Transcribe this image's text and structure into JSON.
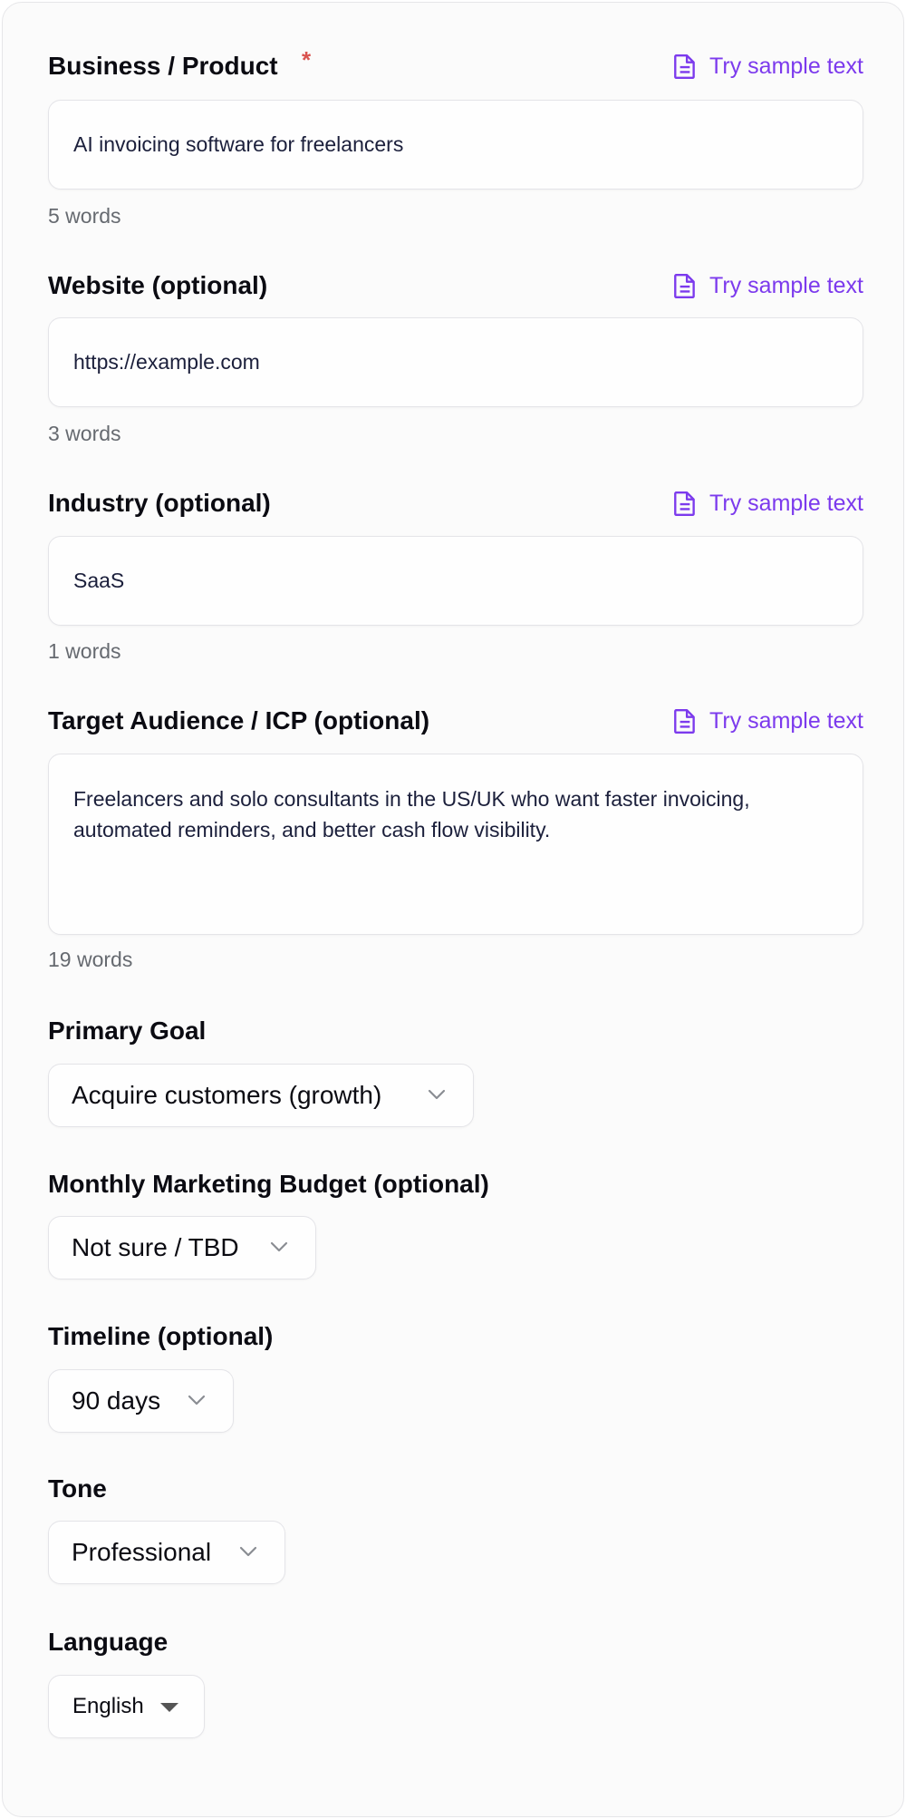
{
  "sample_label": "Try sample text",
  "fields": {
    "business": {
      "label": "Business / Product",
      "required_mark": "*",
      "value": "AI invoicing software for freelancers",
      "count": "5 words"
    },
    "website": {
      "label": "Website (optional)",
      "value": "https://example.com",
      "count": "3 words"
    },
    "industry": {
      "label": "Industry (optional)",
      "value": "SaaS",
      "count": "1 words"
    },
    "audience": {
      "label": "Target Audience / ICP (optional)",
      "value": "Freelancers and solo consultants in the US/UK who want faster invoicing, automated reminders, and better cash flow visibility.",
      "count": "19 words"
    }
  },
  "selects": {
    "goal": {
      "label": "Primary Goal",
      "value": "Acquire customers (growth)"
    },
    "budget": {
      "label": "Monthly Marketing Budget (optional)",
      "value": "Not sure / TBD"
    },
    "timeline": {
      "label": "Timeline (optional)",
      "value": "90 days"
    },
    "tone": {
      "label": "Tone",
      "value": "Professional"
    },
    "language": {
      "label": "Language",
      "value": "English"
    }
  },
  "colors": {
    "accent": "#7c3aed",
    "required": "#d9534f",
    "border": "#e4e4e8",
    "muted": "#666a70"
  },
  "icons": {
    "sample": "document-icon",
    "dropdown": "chevron-down-icon",
    "native_dropdown": "caret-down-icon"
  }
}
